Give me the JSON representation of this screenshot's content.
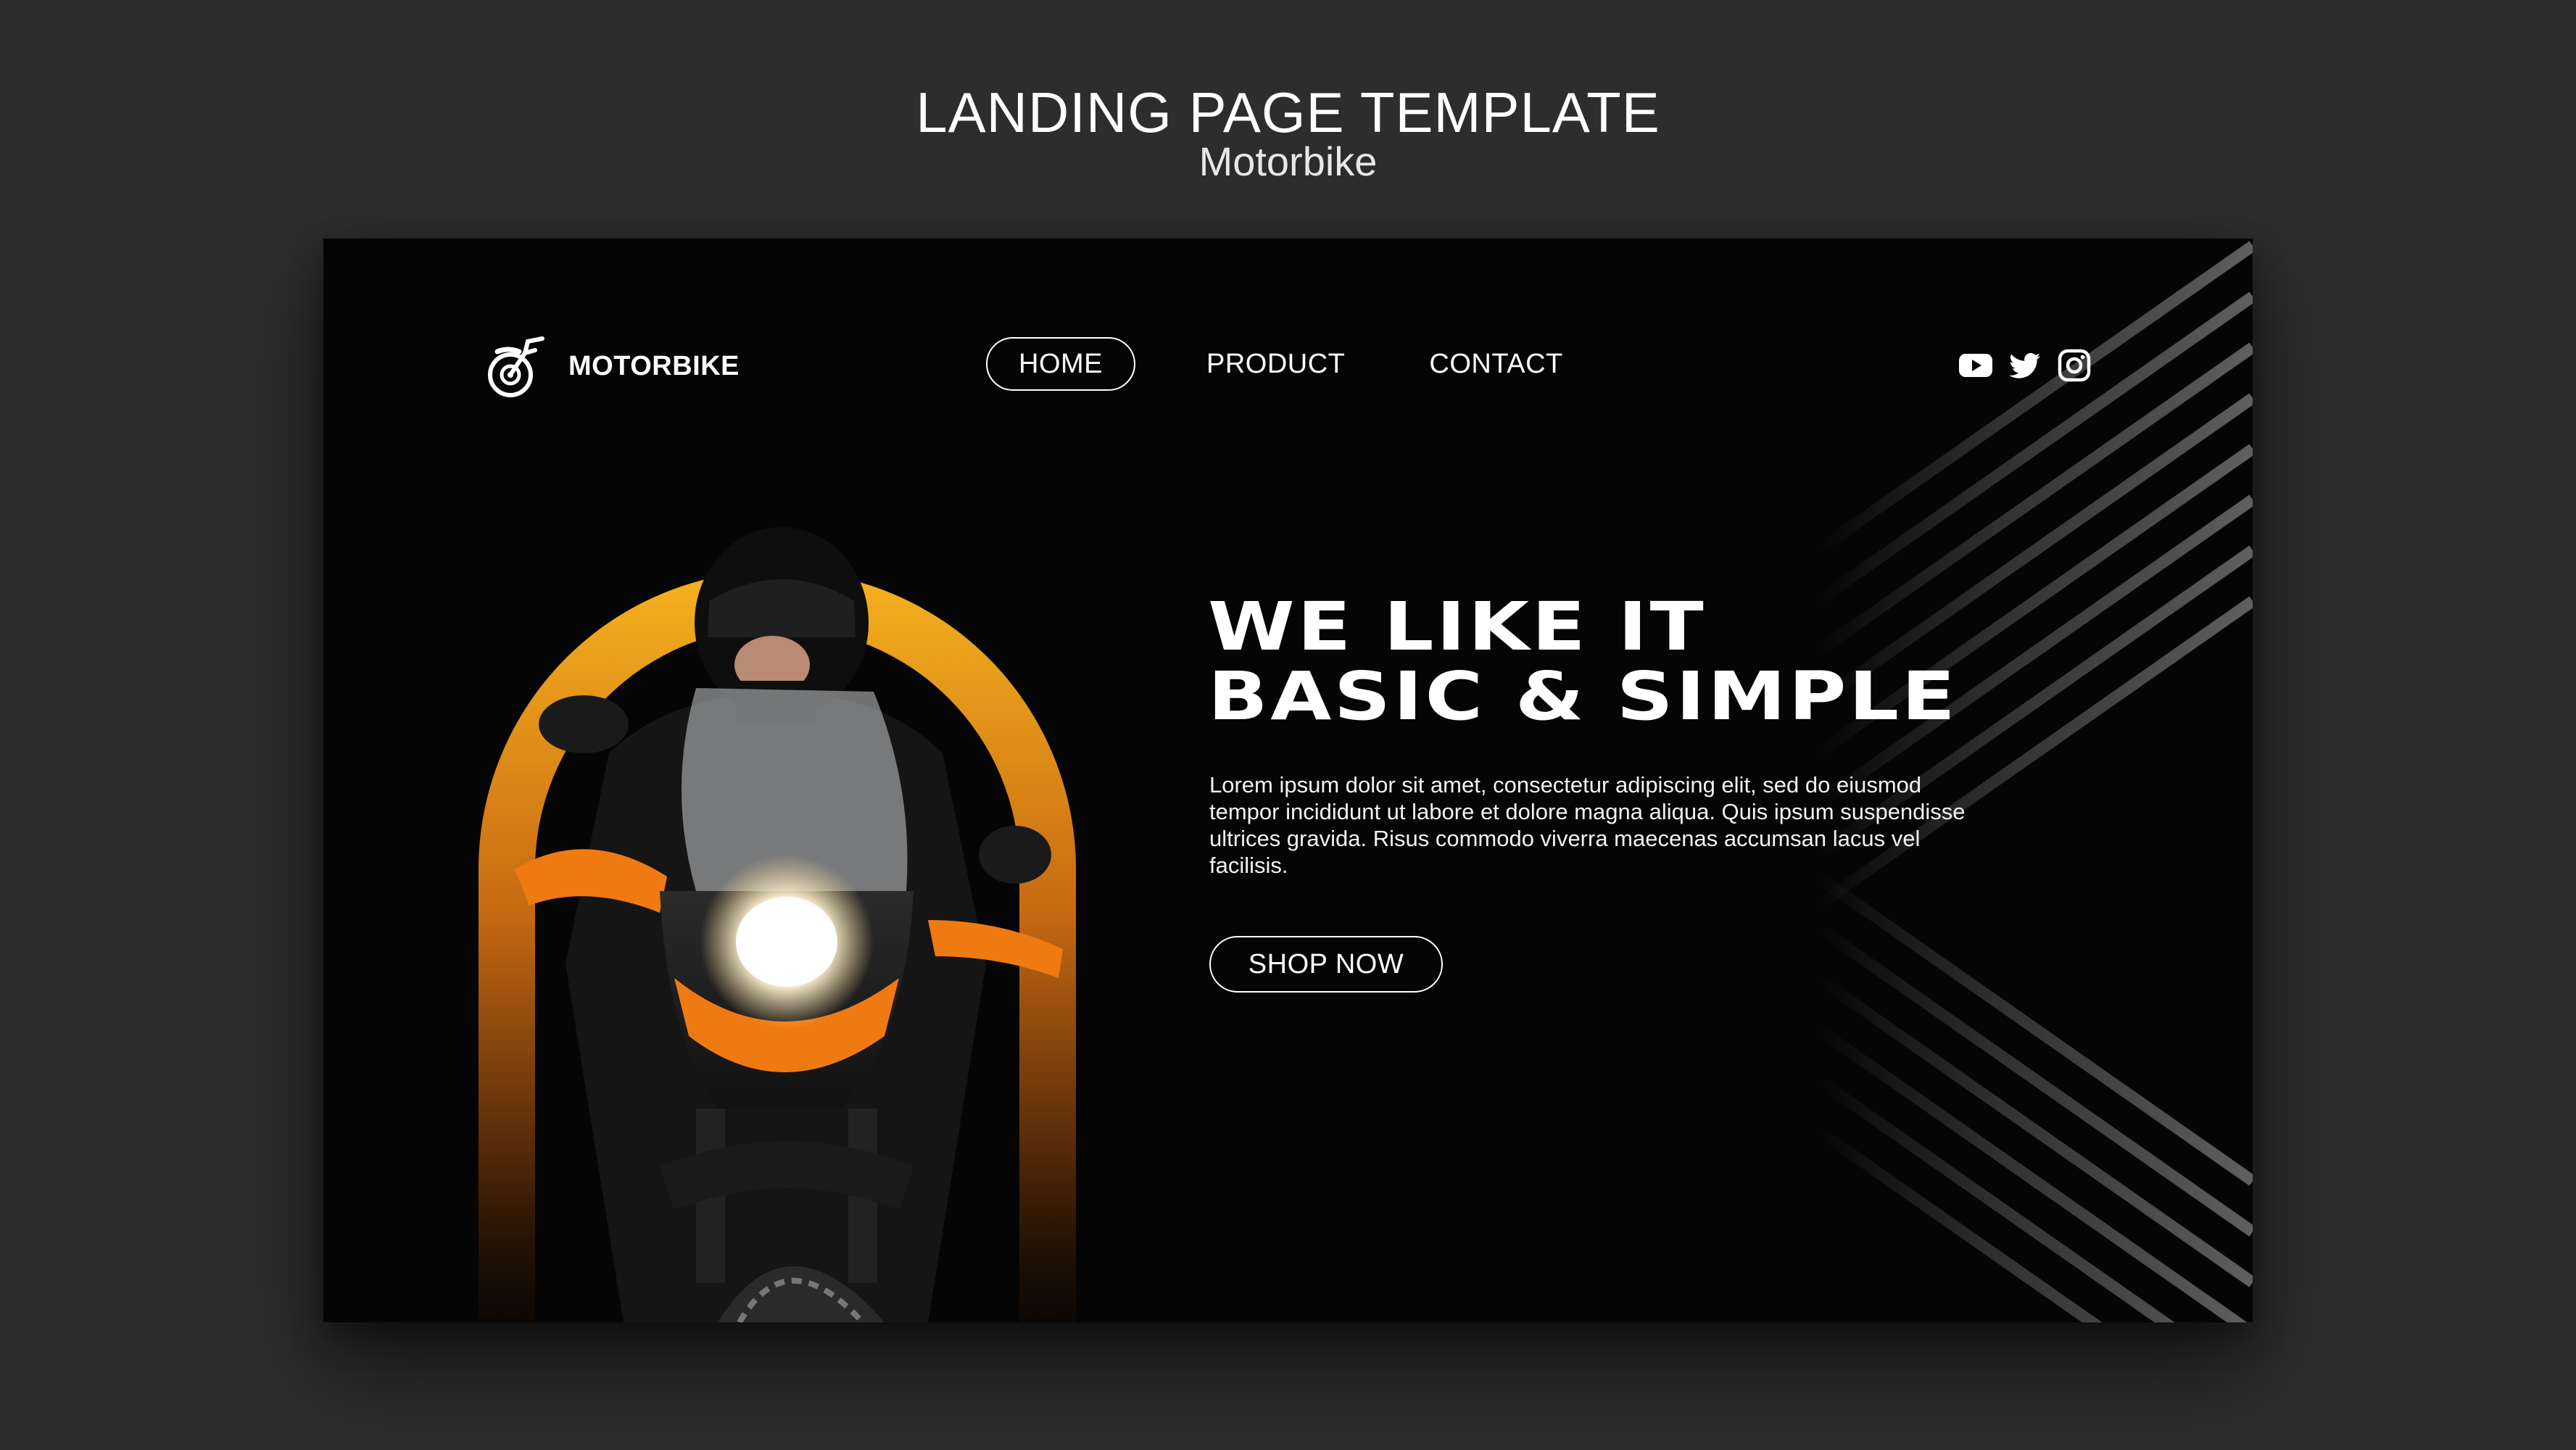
{
  "header": {
    "title": "LANDING PAGE TEMPLATE",
    "subtitle": "Motorbike"
  },
  "brand": {
    "name": "MOTORBIKE",
    "logo_icon": "motorbike-icon"
  },
  "nav": {
    "items": [
      {
        "label": "HOME",
        "active": true
      },
      {
        "label": "PRODUCT",
        "active": false
      },
      {
        "label": "CONTACT",
        "active": false
      }
    ]
  },
  "social": {
    "icons": [
      "youtube-icon",
      "twitter-icon",
      "instagram-icon"
    ]
  },
  "hero": {
    "title_line1": "WE LIKE IT",
    "title_line2": "BASIC & SIMPLE",
    "body": "Lorem ipsum dolor sit amet, consectetur adipiscing elit, sed do eiusmod tempor incididunt ut labore et dolore magna aliqua. Quis ipsum suspendisse ultrices gravida. Risus commodo viverra maecenas accumsan lacus vel facilisis.",
    "cta_label": "SHOP NOW"
  },
  "colors": {
    "page_background": "#2d2d2d",
    "frame_background": "#050505",
    "accent": "#f5a623",
    "text": "#ffffff"
  }
}
